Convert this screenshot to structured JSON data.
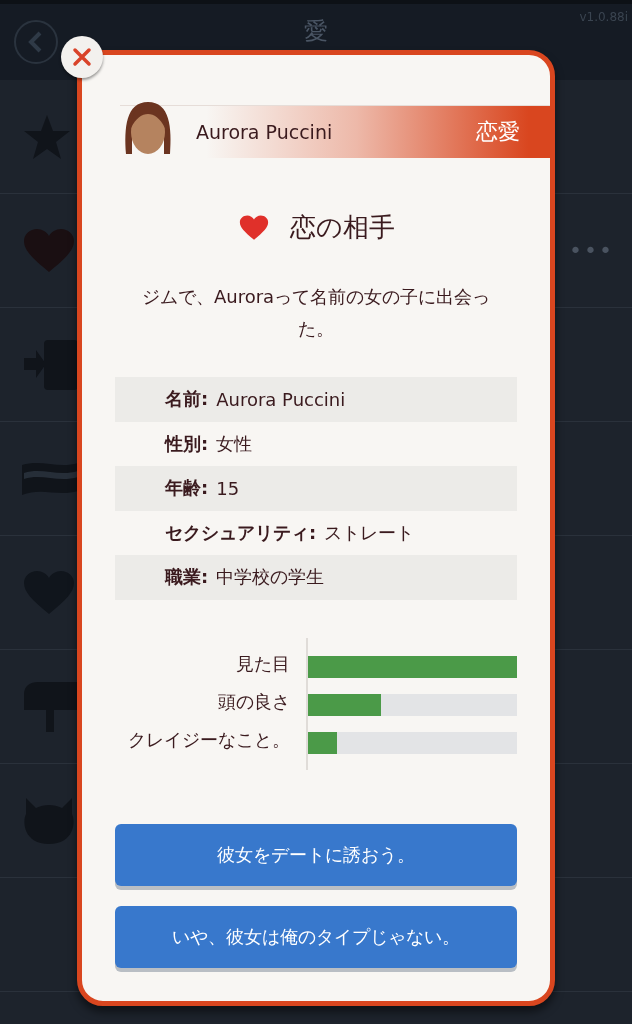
{
  "app_bar": {
    "title": "愛",
    "version": "v1.0.88i"
  },
  "background_list": {
    "more_label": "•••"
  },
  "dialog": {
    "profile": {
      "name": "Aurora Puccini",
      "category": "恋愛"
    },
    "title": "恋の相手",
    "description": "ジムで、Auroraって名前の女の子に出会った。",
    "details": [
      {
        "label": "名前:",
        "value": "Aurora Puccini"
      },
      {
        "label": "性別:",
        "value": "女性"
      },
      {
        "label": "年齢:",
        "value": "15"
      },
      {
        "label": "セクシュアリティ:",
        "value": "ストレート"
      },
      {
        "label": "職業:",
        "value": "中学校の学生"
      }
    ],
    "stats": [
      {
        "label": "見た目",
        "level": 1
      },
      {
        "label": "頭の良さ",
        "level": 0.35
      },
      {
        "label": "クレイジーなこと。",
        "level": 0.14
      }
    ],
    "buttons": [
      "彼女をデートに誘おう。",
      "いや、彼女は俺のタイプじゃない。"
    ]
  }
}
